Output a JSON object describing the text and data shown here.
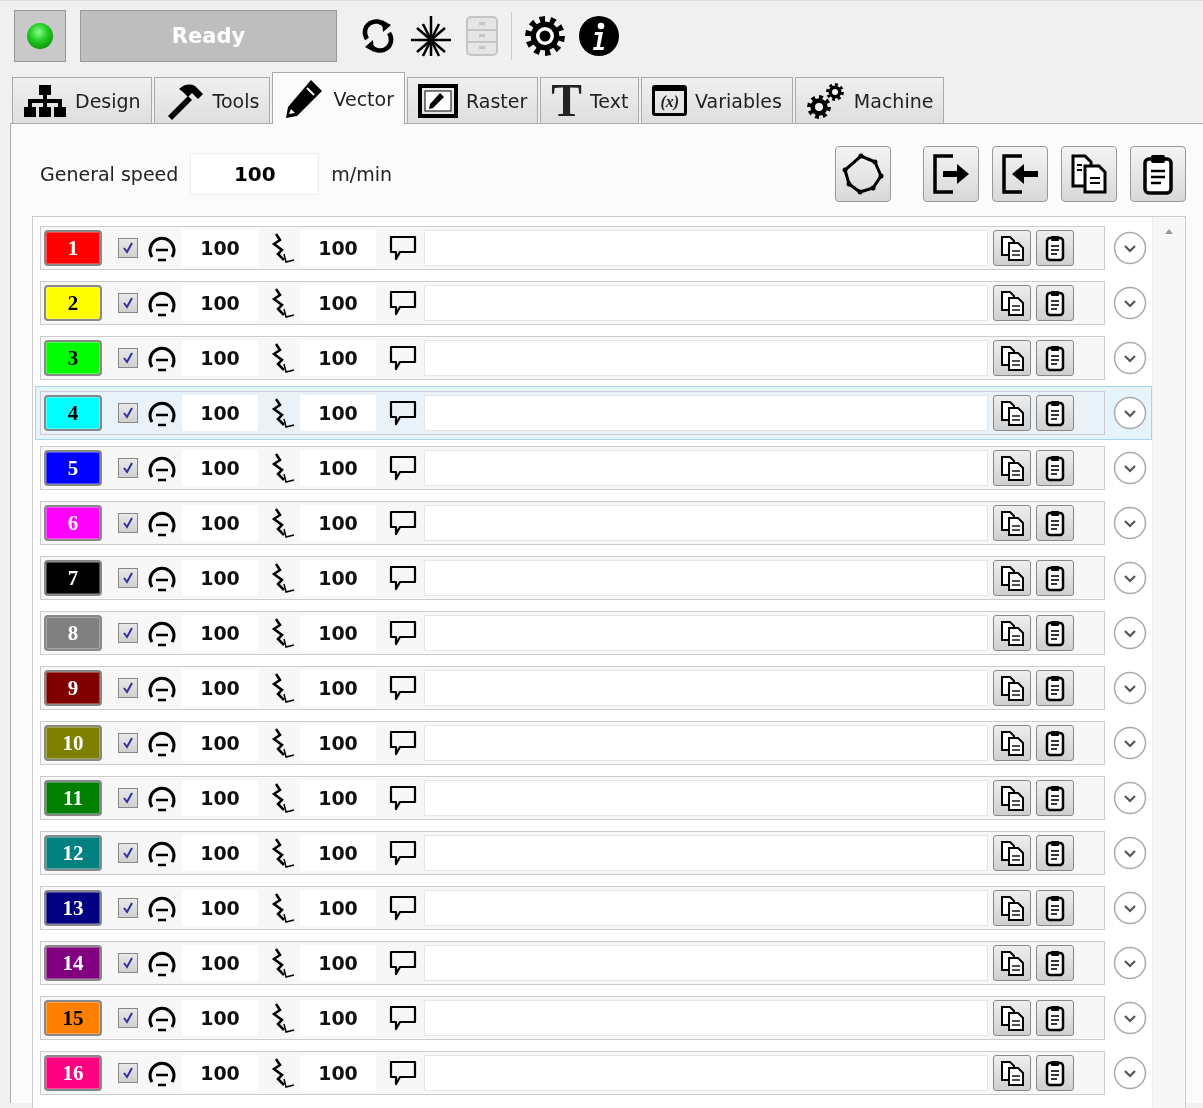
{
  "status": {
    "label": "Ready",
    "led_on": true
  },
  "storage_button": {
    "disabled": true
  },
  "tabs": [
    {
      "kind": "design",
      "label": "Design",
      "selected": false
    },
    {
      "kind": "tools",
      "label": "Tools",
      "selected": false
    },
    {
      "kind": "vector",
      "label": "Vector",
      "selected": true
    },
    {
      "kind": "raster",
      "label": "Raster",
      "selected": false
    },
    {
      "kind": "text",
      "icon_text": "T",
      "label": "Text",
      "selected": false
    },
    {
      "kind": "variables",
      "icon_text": "(x)",
      "label": "Variables",
      "selected": false
    },
    {
      "kind": "machine",
      "label": "Machine",
      "selected": false
    }
  ],
  "general_speed": {
    "label": "General speed",
    "value": "100",
    "unit": "m/min"
  },
  "layers": [
    {
      "number": "1",
      "color": "#ff0000",
      "enabled": true,
      "speed": "100",
      "power": "100",
      "selected": false
    },
    {
      "number": "2",
      "color": "#ffff00",
      "enabled": true,
      "speed": "100",
      "power": "100",
      "selected": false
    },
    {
      "number": "3",
      "color": "#00ff00",
      "enabled": true,
      "speed": "100",
      "power": "100",
      "selected": false
    },
    {
      "number": "4",
      "color": "#00ffff",
      "enabled": true,
      "speed": "100",
      "power": "100",
      "selected": true
    },
    {
      "number": "5",
      "color": "#0000ff",
      "enabled": true,
      "speed": "100",
      "power": "100",
      "selected": false
    },
    {
      "number": "6",
      "color": "#ff00ff",
      "enabled": true,
      "speed": "100",
      "power": "100",
      "selected": false
    },
    {
      "number": "7",
      "color": "#000000",
      "enabled": true,
      "speed": "100",
      "power": "100",
      "selected": false
    },
    {
      "number": "8",
      "color": "#808080",
      "enabled": true,
      "speed": "100",
      "power": "100",
      "selected": false
    },
    {
      "number": "9",
      "color": "#800000",
      "enabled": true,
      "speed": "100",
      "power": "100",
      "selected": false
    },
    {
      "number": "10",
      "color": "#808000",
      "enabled": true,
      "speed": "100",
      "power": "100",
      "selected": false
    },
    {
      "number": "11",
      "color": "#008000",
      "enabled": true,
      "speed": "100",
      "power": "100",
      "selected": false
    },
    {
      "number": "12",
      "color": "#008080",
      "enabled": true,
      "speed": "100",
      "power": "100",
      "selected": false
    },
    {
      "number": "13",
      "color": "#000080",
      "enabled": true,
      "speed": "100",
      "power": "100",
      "selected": false
    },
    {
      "number": "14",
      "color": "#800080",
      "enabled": true,
      "speed": "100",
      "power": "100",
      "selected": false
    },
    {
      "number": "15",
      "color": "#ff8000",
      "enabled": true,
      "speed": "100",
      "power": "100",
      "selected": false
    },
    {
      "number": "16",
      "color": "#ff0080",
      "enabled": true,
      "speed": "100",
      "power": "100",
      "selected": false
    }
  ]
}
